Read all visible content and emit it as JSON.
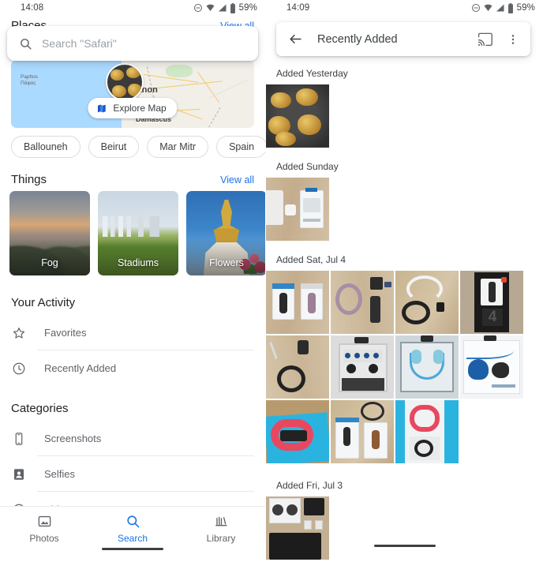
{
  "left": {
    "status": {
      "time": "14:08",
      "battery": "59%",
      "icons": [
        "dnd-icon",
        "wifi-icon",
        "signal-icon",
        "battery-icon"
      ]
    },
    "places": {
      "title": "Places",
      "view_all": "View all"
    },
    "search": {
      "placeholder": "Search \"Safari\"",
      "icon": "search-icon"
    },
    "map": {
      "explore_label": "Explore Map",
      "explore_icon": "map-icon",
      "labels": [
        {
          "text": "Paphos",
          "sub": "Πάφος"
        },
        {
          "text": "Lebanon"
        },
        {
          "text": "Damascus"
        }
      ]
    },
    "chips": [
      "Ballouneh",
      "Beirut",
      "Mar Mitr",
      "Spain",
      ""
    ],
    "things": {
      "title": "Things",
      "view_all": "View all",
      "items": [
        {
          "label": "Fog"
        },
        {
          "label": "Stadiums"
        },
        {
          "label": "Flowers"
        },
        {
          "label": ""
        }
      ]
    },
    "your_activity": {
      "title": "Your Activity",
      "items": [
        {
          "label": "Favorites",
          "icon": "star-icon"
        },
        {
          "label": "Recently Added",
          "icon": "clock-icon"
        }
      ]
    },
    "categories": {
      "title": "Categories",
      "items": [
        {
          "label": "Screenshots",
          "icon": "phone-icon"
        },
        {
          "label": "Selfies",
          "icon": "person-icon"
        },
        {
          "label": "Videos",
          "icon": "play-circle-icon"
        }
      ]
    },
    "bottom_nav": [
      {
        "label": "Photos",
        "icon": "photo-icon",
        "active": false
      },
      {
        "label": "Search",
        "icon": "search-icon",
        "active": true
      },
      {
        "label": "Library",
        "icon": "library-icon",
        "active": false
      }
    ],
    "accent_color": "#1a73e8"
  },
  "right": {
    "status": {
      "time": "14:09",
      "battery": "59%"
    },
    "appbar": {
      "title": "Recently Added",
      "back_icon": "back-arrow-icon",
      "cast_icon": "cast-icon",
      "overflow_icon": "more-vert-icon"
    },
    "groups": [
      {
        "heading": "Added Yesterday",
        "count": 1
      },
      {
        "heading": "Added Sunday",
        "count": 1
      },
      {
        "heading": "Added Sat, Jul 4",
        "count": 11
      },
      {
        "heading": "Added Fri, Jul 3",
        "count": 1
      }
    ]
  }
}
